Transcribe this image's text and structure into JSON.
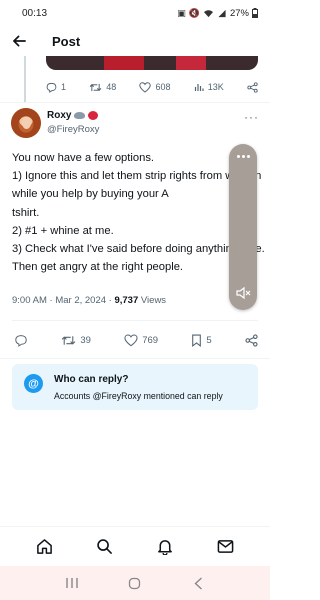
{
  "status_bar": {
    "time": "00:13",
    "battery": "27%",
    "icons": [
      "nfc-icon",
      "mute-icon",
      "wifi-icon",
      "signal-icon",
      "battery-icon"
    ]
  },
  "header": {
    "title": "Post",
    "back_icon": "back-arrow-icon"
  },
  "previous_tweet": {
    "replies": "1",
    "retweets": "48",
    "likes": "608",
    "views": "13K"
  },
  "tweet": {
    "author_name": "Roxy",
    "author_emojis": [
      "rat-emoji",
      "tomato-emoji"
    ],
    "handle": "@FireyRoxy",
    "text": "You now have a few options.\n1) Ignore this and let them strip rights from women while you help by buying your A\ntshirt.\n2) #1 + whine at me.\n3) Check what I've said before doing anything else. Then get angry at the right people.",
    "time": "9:00 AM",
    "date": "Mar 2, 2024",
    "views_count": "9,737",
    "views_label": "Views",
    "retweets": "39",
    "likes": "769",
    "bookmarks": "5"
  },
  "reply_restriction": {
    "title": "Who can reply?",
    "description": "Accounts @FireyRoxy mentioned can reply",
    "icon_text": "@"
  },
  "bottom_nav": [
    "home-icon",
    "search-icon",
    "notifications-icon",
    "messages-icon"
  ],
  "colors": {
    "accent": "#1d9bf0",
    "text": "#0f1419",
    "muted": "#536471",
    "reply_box_bg": "#e8f5fd",
    "overlay": "#a89e98",
    "system_nav_bg": "#fff0f0"
  }
}
